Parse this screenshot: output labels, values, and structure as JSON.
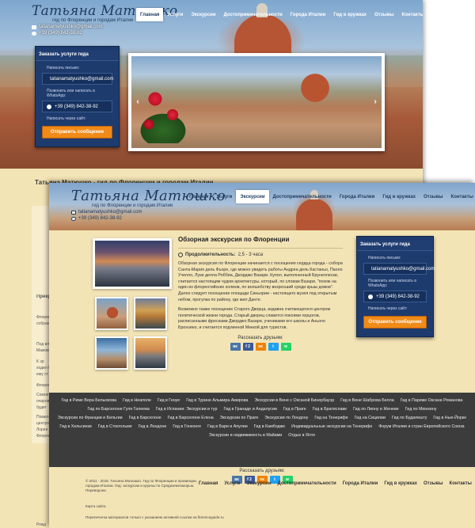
{
  "site": {
    "logo_text": "Татьяна Матюшко",
    "logo_subtitle": "гид по Флоренции и городам Италии",
    "email": "tatianamatyushko@gmail.com",
    "phone": "+39 (349) 842-38-92"
  },
  "nav": [
    {
      "label": "Главная"
    },
    {
      "label": "Услуги"
    },
    {
      "label": "Экскурсии"
    },
    {
      "label": "Достопримечательности"
    },
    {
      "label": "Города Италии"
    },
    {
      "label": "Гид в кружках"
    },
    {
      "label": "Отзывы"
    },
    {
      "label": "Контакты"
    }
  ],
  "back_page": {
    "active_nav": "Главная",
    "heading_partial": "Татьяна Матюшко - гид по Флоренции и городам Италии",
    "snippets": [
      "Прекра",
      "Флорен",
      "собран",
      "Под вл",
      "Мажов",
      "К эр",
      "ходил М",
      "ему ст",
      "Флорен",
      "Сомне",
      "очаров",
      "будет",
      "Помил",
      "центро",
      "Лорен",
      "Флорен",
      "Рожд"
    ]
  },
  "order_form": {
    "title": "Заказать услуги гида",
    "email_label": "Написать письмо:",
    "email_value": "tatianamatyushko@gmail.com",
    "whatsapp_label": "Позвонить или написать в WhatsApp:",
    "phone_value": "+39 (349) 842-38-92",
    "site_label": "Написать через сайт:",
    "submit_label": "Отправить сообщение"
  },
  "front_page": {
    "active_nav": "Экскурсии",
    "article": {
      "title": "Обзорная экскурсия по Флоренции",
      "duration_label": "Продолжительность:",
      "duration_value": "2,5 - 3 часа",
      "paragraph_1": "Обзорная экскурсия по Флоренции начинается с посещения сердца города - собора Санта-Мария дель Фьоре, где можно увидеть работы Андреа дель Кастаньо, Паоло Учелло, Луки делла Роббиа, Джорджо Вазари. Купол, выполненный Брунеллески, считается настоящим чудом архитектуры, который, по словам Вазари, \"похож на один из флорентийских холмов, по волшебству возросший среди крыш домов\". Далее следует посещение площади Синьории - настоящего музея под открытым небом, прогулка по району, где жил Данте.",
      "paragraph_2": "Возможно также посещение Старого Дворца, издавна считающегося центром политической жизни города. Старый дворец славится покоями герцогов, расписанными фресками Джорджо Вазари, учениками его школы и Аньоло Бронзино, и считается подлинной Меккой для туристов."
    },
    "share": {
      "title": "Рассказать друзьям:",
      "buttons": [
        {
          "icon": "vk-icon",
          "text": "вк",
          "color": "#4a76a8"
        },
        {
          "icon": "facebook-icon",
          "text": "f 2",
          "color": "#3b5998"
        },
        {
          "icon": "odnoklassniki-icon",
          "text": "ок",
          "color": "#ee8208"
        },
        {
          "icon": "twitter-icon",
          "text": "t",
          "color": "#1da1f2"
        },
        {
          "icon": "whatsapp-icon",
          "text": "w",
          "color": "#25d366"
        }
      ]
    },
    "footer_links": [
      "Гид в Риме Вера Белыхкова",
      "Гид в Неаполе",
      "Гид в Генуе",
      "Гид в Турине Альмира Амирова",
      "Экскурсии в Вене с Оксаной Бинербауэр",
      "Гид в Вене Шаброва Белла",
      "Гид в Париже Оксана Романова",
      "Гид по Барселоне Гуля Галеева",
      "Гид в Испании: Экскурсии и тур",
      "Гид в Гранаде и Андалусии",
      "Гид в Праге",
      "Гид в Братиславе",
      "Гид по Лиону и Женеве",
      "Гид по Мюнхену",
      "Экскурсии по Франции и Бельгии",
      "Гид в Барселоне",
      "Гид в Барселоне Елена",
      "Экскурсии по Праге",
      "Экскурсии по Лондону",
      "Гид на Тенерифе",
      "Гид на Сицилии",
      "Гид по Будапешту",
      "Гид в Нью-Йорке",
      "Гид в Хельсинки",
      "Гид в Стокгольме",
      "Гид в Лондоне",
      "Гид в Гонконге",
      "Гид в Бари и Апулии",
      "Гид в Камбодже",
      "Индивидуальные экскурсии на Тенерифе",
      "Форум Италии и стран Европейского Союза",
      "Экскурсии и недвижимость в Майами",
      "Отдых в Ялте"
    ],
    "footer": {
      "copyright": "© 2011 - 2016. Татьяна Матюшко. Гид по Флоренции и провинции, городам Италии. Гид: экскурсии и круизы по Средиземноморью. Переводчик.",
      "map": "Карта сайта",
      "repost": "Перепечатка материалов только с указанием активной ссылки на florenceguide.ru"
    }
  },
  "colors": {
    "page_bg": "#f3e4b6",
    "panel_bg": "#1e3b6e",
    "cta": "#f08a18",
    "footer_bg": "#3c3c3c"
  }
}
